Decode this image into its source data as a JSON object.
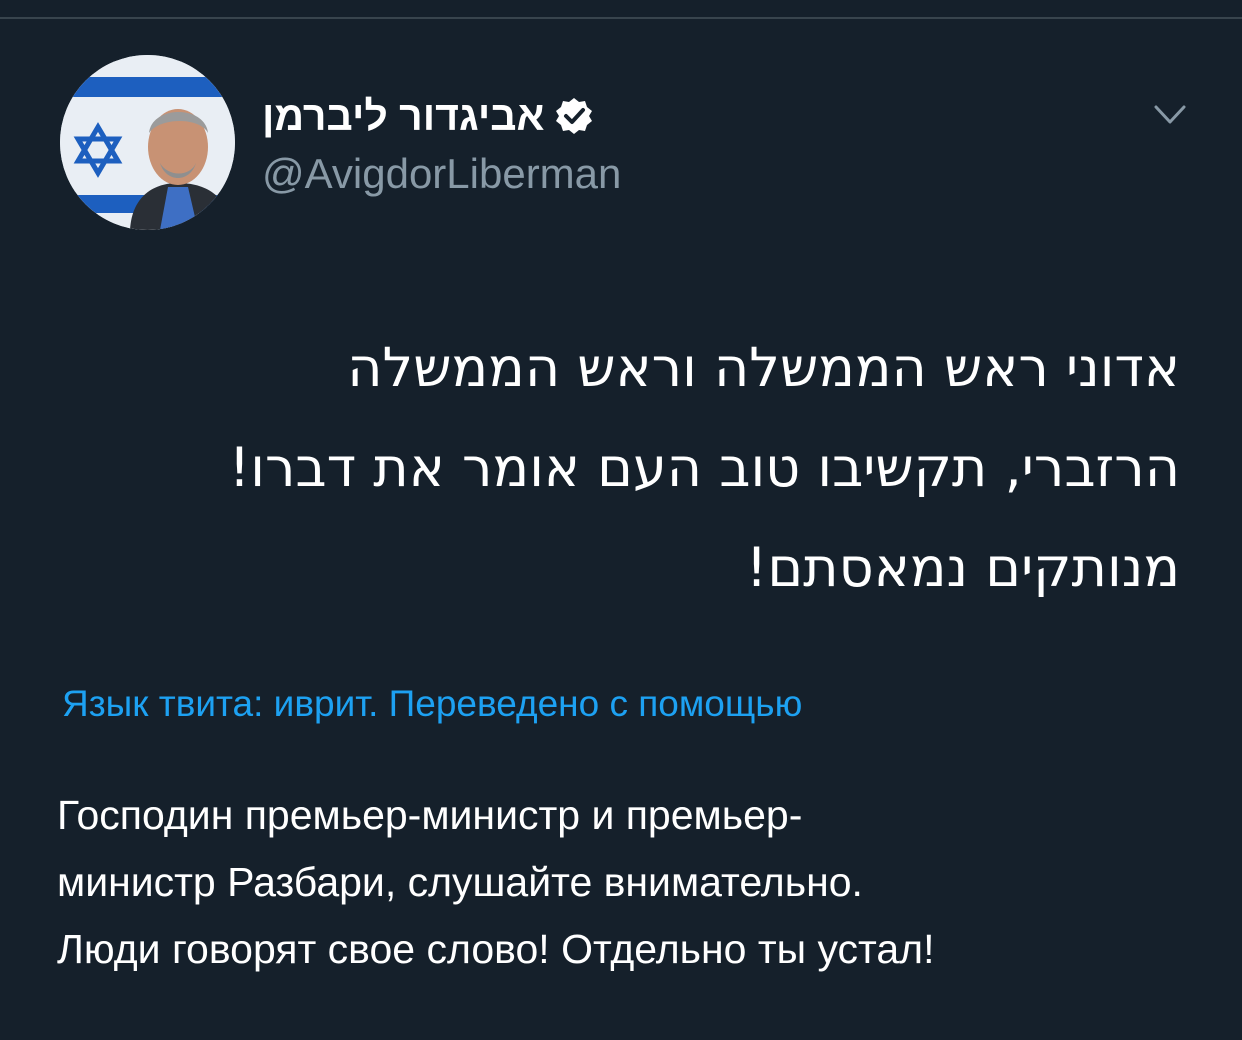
{
  "tweet": {
    "author": {
      "display_name": "אביגדור ליברמן",
      "handle": "@AvigdorLiberman",
      "verified": true
    },
    "text_lines": [
      "אדוני ראש הממשלה וראש הממשלה",
      "הרזברי, תקשיבו טוב העם אומר את דברו!",
      "מנותקים נמאסתם!"
    ],
    "translation_notice": "Язык твита: иврит. Переведено с помощью",
    "translated_lines": [
      "Господин премьер-министр и премьер-",
      "министр Разбари, слушайте внимательно.",
      "Люди говорят свое слово! Отдельно ты устал!"
    ]
  },
  "colors": {
    "background": "#15202b",
    "text": "#ffffff",
    "secondary_text": "#8899a6",
    "link": "#1da1f2",
    "divider": "#38444d"
  },
  "icons": {
    "verified": "verified-badge-icon",
    "menu": "chevron-down-icon"
  }
}
